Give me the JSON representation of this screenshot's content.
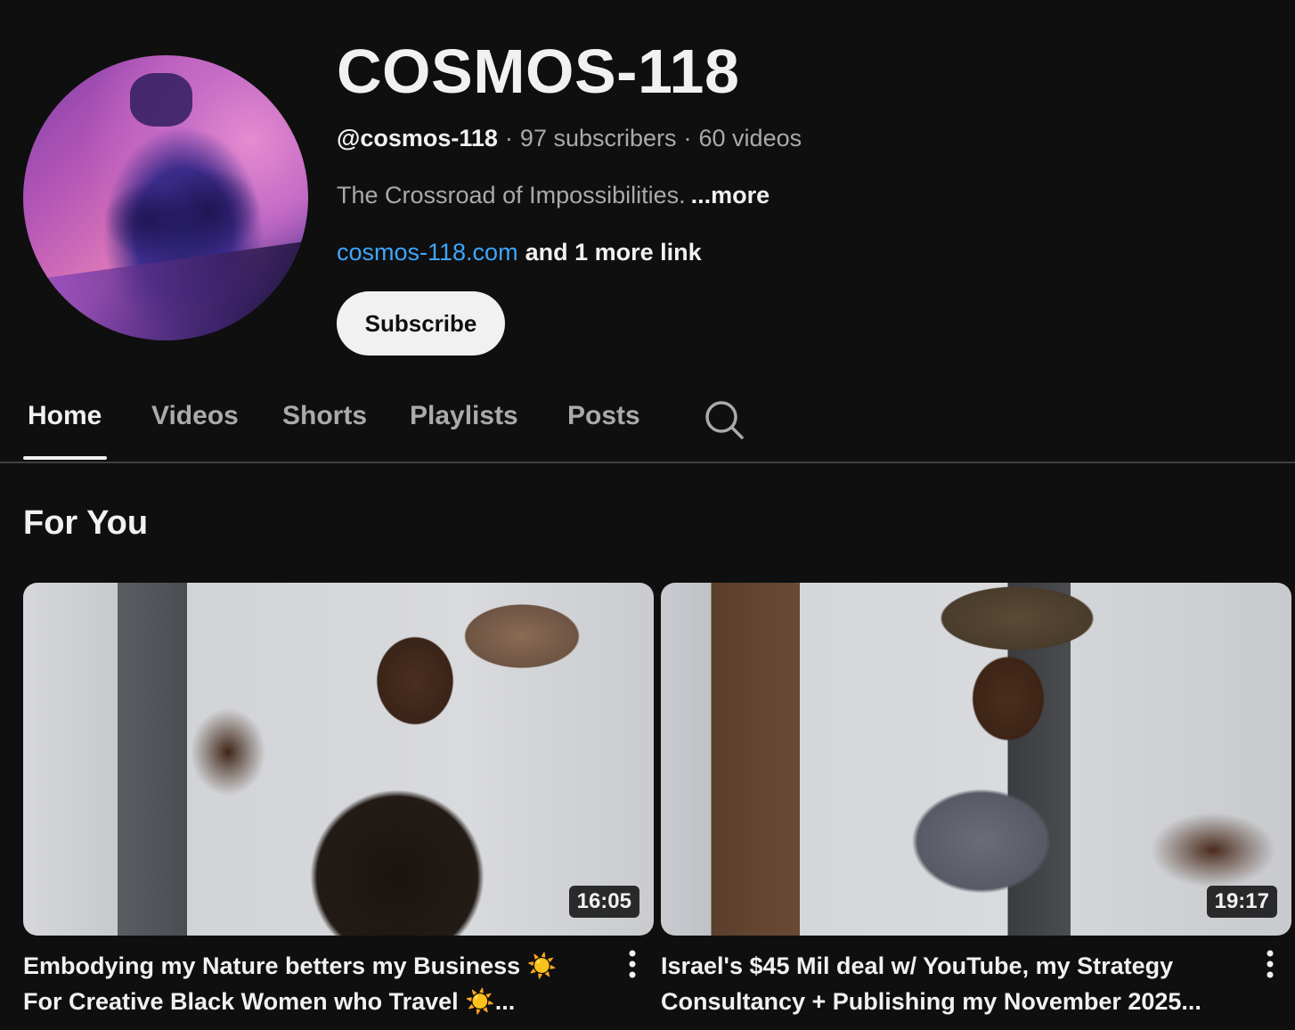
{
  "channel": {
    "name": "COSMOS-118",
    "handle": "@cosmos-118",
    "separator": "·",
    "subscribers": "97 subscribers",
    "videos_count": "60 videos",
    "description": "The Crossroad of Impossibilities.",
    "description_more": "...more",
    "link": "cosmos-118.com",
    "more_links": "and 1 more link",
    "subscribe_label": "Subscribe"
  },
  "tabs": [
    {
      "label": "Home",
      "active": true
    },
    {
      "label": "Videos",
      "active": false
    },
    {
      "label": "Shorts",
      "active": false
    },
    {
      "label": "Playlists",
      "active": false
    },
    {
      "label": "Posts",
      "active": false
    }
  ],
  "section": {
    "title": "For You"
  },
  "videos": [
    {
      "title": "Embodying my Nature betters my Business ☀️ For Creative Black Women who Travel ☀️...",
      "duration": "16:05"
    },
    {
      "title": "Israel's $45 Mil deal w/ YouTube, my Strategy Consultancy + Publishing my November 2025...",
      "duration": "19:17"
    }
  ],
  "colors": {
    "background": "#0f0f0f",
    "text_primary": "#f1f1f1",
    "text_secondary": "#aaaaaa",
    "link": "#3ea6ff",
    "subscribe_bg": "#f1f1f1",
    "divider": "#3f3f3f"
  },
  "icons": {
    "search": "search-icon",
    "more": "more-vert-icon"
  }
}
